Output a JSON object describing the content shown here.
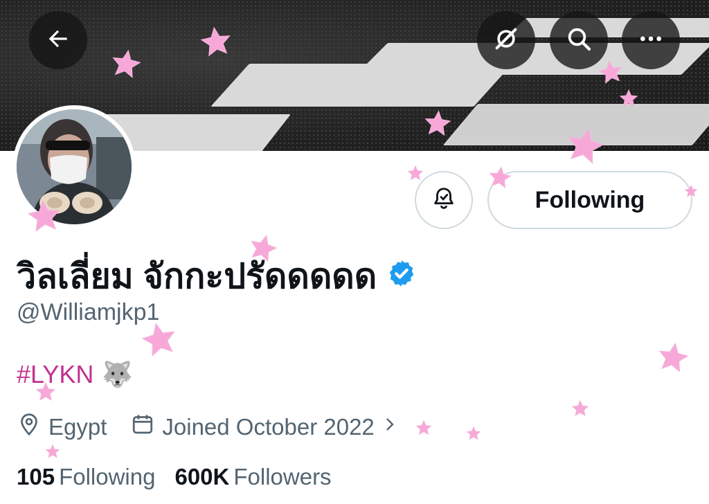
{
  "header": {
    "back_icon": "back-arrow-icon",
    "grok_icon": "grok-icon",
    "search_icon": "search-icon",
    "more_icon": "more-icon"
  },
  "profile": {
    "display_name": "วิลเลี่ยม จักกะปรัดดดดด",
    "verified": true,
    "handle": "@Williamjkp1",
    "bio_tag": "#LYKN",
    "bio_emoji": "🐺",
    "location": "Egypt",
    "joined": "Joined October 2022",
    "following_count": "105",
    "following_label": "Following",
    "followers_count": "600K",
    "followers_label": "Followers"
  },
  "actions": {
    "notify_icon": "bell-check-icon",
    "follow_label": "Following"
  },
  "colors": {
    "accent_blue": "#1d9bf0",
    "hashtag": "#c1318f",
    "star_pink": "#f7a8d8",
    "secondary_text": "#536471"
  }
}
